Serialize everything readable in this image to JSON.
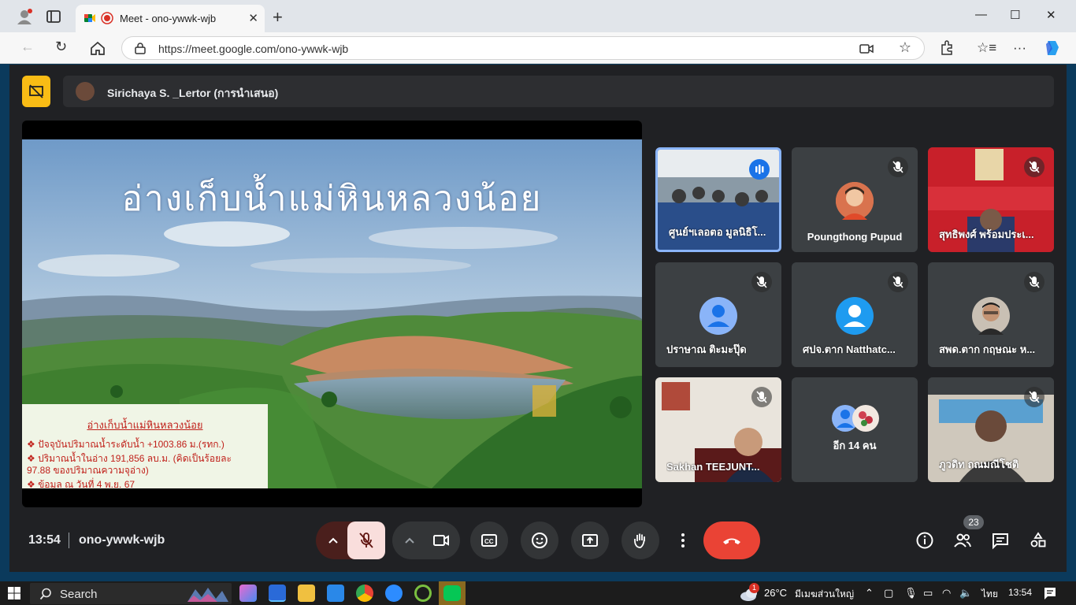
{
  "browser": {
    "tab_title": "Meet - ono-ywwk-wjb",
    "tab_close": "✕",
    "new_tab": "+",
    "url": "https://meet.google.com/ono-ywwk-wjb"
  },
  "presenter": {
    "name": "Sirichaya S. _Lertor (การนำเสนอ)"
  },
  "slide": {
    "title": "อ่างเก็บน้ำแม่หินหลวงน้อย",
    "info_heading": "อ่างเก็บน้ำแม่หินหลวงน้อย",
    "info_lines": [
      "❖ ปัจจุบันปริมาณน้ำระดับน้ำ +1003.86 ม.(รทก.)",
      "❖ ปริมาณน้ำในอ่าง 191,856 ลบ.ม. (คิดเป็นร้อยละ",
      "    97.88 ของปริมาณความจุอ่าง)",
      "❖ ข้อมูล ณ วันที่ 4 พ.ย. 67"
    ]
  },
  "participants": [
    {
      "name": "ศูนย์ฯเลอตอ มูลนิธิโ...",
      "speaking": true
    },
    {
      "name": "Poungthong Pupud",
      "muted": true
    },
    {
      "name": "สุทธิพงศ์ พร้อมประเ...",
      "muted": true
    },
    {
      "name": "ปราษาณ ติะมะปุ๊ด",
      "muted": true
    },
    {
      "name": "ศปจ.ตาก Natthatc...",
      "muted": true
    },
    {
      "name": "สพด.ตาก กฤษณะ ห...",
      "muted": true
    },
    {
      "name": "Sakhan TEEJUNT...",
      "muted": true
    },
    {
      "name": "อีก 14 คน"
    },
    {
      "name": "ภูวดิท ถณมณีโชติ",
      "muted": true
    }
  ],
  "bottom": {
    "time": "13:54",
    "meeting_code": "ono-ywwk-wjb",
    "people_count": "23"
  },
  "taskbar": {
    "search_label": "Search",
    "temperature": "26°C",
    "weather": "มีเมฆส่วนใหญ่",
    "language": "ไทย",
    "time": "13:54",
    "weather_badge": "1"
  },
  "colors": {
    "meet_bg": "#202124",
    "end_call": "#ea4335",
    "mic_off_bg": "#f9dedc",
    "present_yellow": "#f9bc15",
    "speaking_border": "#8ab4f8"
  }
}
